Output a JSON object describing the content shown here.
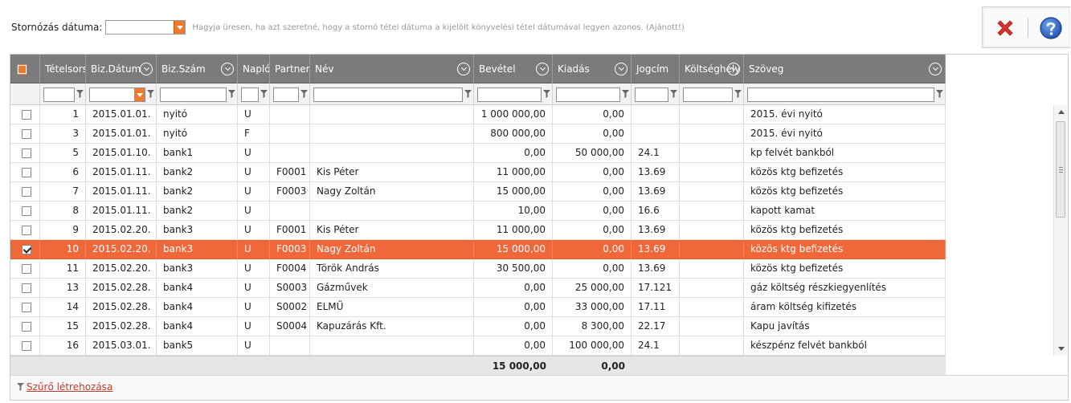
{
  "datebar": {
    "label": "Stornózás dátuma:",
    "value": "",
    "hint": "Hagyja üresen, ha azt szeretné, hogy a stornó tétel dátuma a kijelölt könyvelési tétel dátumával legyen azonos. (Ajánott!)"
  },
  "toolbar": {
    "close_icon": "close-icon",
    "help_icon": "help-icon"
  },
  "grid": {
    "columns": [
      {
        "key": "chk",
        "label": ""
      },
      {
        "key": "tetel",
        "label": "Tételsors"
      },
      {
        "key": "datum",
        "label": "Biz.Dátum"
      },
      {
        "key": "szam",
        "label": "Biz.Szám"
      },
      {
        "key": "naplo",
        "label": "Napló"
      },
      {
        "key": "partner",
        "label": "Partner"
      },
      {
        "key": "nev",
        "label": "Név"
      },
      {
        "key": "bevetel",
        "label": "Bevétel"
      },
      {
        "key": "kiadas",
        "label": "Kiadás"
      },
      {
        "key": "jogcim",
        "label": "Jogcím"
      },
      {
        "key": "koltseg",
        "label": "Költséghely"
      },
      {
        "key": "szoveg",
        "label": "Szöveg"
      }
    ],
    "rows": [
      {
        "checked": false,
        "selected": false,
        "tetel": "1",
        "datum": "2015.01.01.",
        "szam": "nyitó",
        "naplo": "U",
        "partner": "",
        "nev": "",
        "bevetel": "1 000 000,00",
        "kiadas": "0,00",
        "jogcim": "",
        "koltseg": "",
        "szoveg": "2015. évi nyitó"
      },
      {
        "checked": false,
        "selected": false,
        "tetel": "3",
        "datum": "2015.01.01.",
        "szam": "nyitó",
        "naplo": "F",
        "partner": "",
        "nev": "",
        "bevetel": "800 000,00",
        "kiadas": "0,00",
        "jogcim": "",
        "koltseg": "",
        "szoveg": "2015. évi nyitó"
      },
      {
        "checked": false,
        "selected": false,
        "tetel": "5",
        "datum": "2015.01.10.",
        "szam": "bank1",
        "naplo": "U",
        "partner": "",
        "nev": "",
        "bevetel": "0,00",
        "kiadas": "50 000,00",
        "jogcim": "24.1",
        "koltseg": "",
        "szoveg": "kp felvét bankból"
      },
      {
        "checked": false,
        "selected": false,
        "tetel": "6",
        "datum": "2015.01.11.",
        "szam": "bank2",
        "naplo": "U",
        "partner": "F0001",
        "nev": "Kis Péter",
        "bevetel": "11 000,00",
        "kiadas": "0,00",
        "jogcim": "13.69",
        "koltseg": "",
        "szoveg": "közös ktg befizetés"
      },
      {
        "checked": false,
        "selected": false,
        "tetel": "7",
        "datum": "2015.01.11.",
        "szam": "bank2",
        "naplo": "U",
        "partner": "F0003",
        "nev": "Nagy Zoltán",
        "bevetel": "15 000,00",
        "kiadas": "0,00",
        "jogcim": "13.69",
        "koltseg": "",
        "szoveg": "közös ktg befizetés"
      },
      {
        "checked": false,
        "selected": false,
        "tetel": "8",
        "datum": "2015.01.11.",
        "szam": "bank2",
        "naplo": "U",
        "partner": "",
        "nev": "",
        "bevetel": "10,00",
        "kiadas": "0,00",
        "jogcim": "16.6",
        "koltseg": "",
        "szoveg": "kapott kamat"
      },
      {
        "checked": false,
        "selected": false,
        "tetel": "9",
        "datum": "2015.02.20.",
        "szam": "bank3",
        "naplo": "U",
        "partner": "F0001",
        "nev": "Kis Péter",
        "bevetel": "11 000,00",
        "kiadas": "0,00",
        "jogcim": "13.69",
        "koltseg": "",
        "szoveg": "közös ktg befizetés"
      },
      {
        "checked": true,
        "selected": true,
        "tetel": "10",
        "datum": "2015.02.20.",
        "szam": "bank3",
        "naplo": "U",
        "partner": "F0003",
        "nev": "Nagy Zoltán",
        "bevetel": "15 000,00",
        "kiadas": "0,00",
        "jogcim": "13.69",
        "koltseg": "",
        "szoveg": "közös ktg befizetés"
      },
      {
        "checked": false,
        "selected": false,
        "tetel": "11",
        "datum": "2015.02.20.",
        "szam": "bank3",
        "naplo": "U",
        "partner": "F0004",
        "nev": "Török András",
        "bevetel": "30 500,00",
        "kiadas": "0,00",
        "jogcim": "13.69",
        "koltseg": "",
        "szoveg": "közös ktg befizetés"
      },
      {
        "checked": false,
        "selected": false,
        "tetel": "13",
        "datum": "2015.02.28.",
        "szam": "bank4",
        "naplo": "U",
        "partner": "S0003",
        "nev": "Gázművek",
        "bevetel": "0,00",
        "kiadas": "25 000,00",
        "jogcim": "17.121",
        "koltseg": "",
        "szoveg": "gáz költség részkiegyenlítés"
      },
      {
        "checked": false,
        "selected": false,
        "tetel": "14",
        "datum": "2015.02.28.",
        "szam": "bank4",
        "naplo": "U",
        "partner": "S0002",
        "nev": "ELMŰ",
        "bevetel": "0,00",
        "kiadas": "33 000,00",
        "jogcim": "17.11",
        "koltseg": "",
        "szoveg": "áram költség kifizetés"
      },
      {
        "checked": false,
        "selected": false,
        "tetel": "15",
        "datum": "2015.02.28.",
        "szam": "bank4",
        "naplo": "U",
        "partner": "S0004",
        "nev": "Kapuzárás Kft.",
        "bevetel": "0,00",
        "kiadas": "8 300,00",
        "jogcim": "22.17",
        "koltseg": "",
        "szoveg": "Kapu javítás"
      },
      {
        "checked": false,
        "selected": false,
        "tetel": "16",
        "datum": "2015.03.01.",
        "szam": "bank5",
        "naplo": "U",
        "partner": "",
        "nev": "",
        "bevetel": "0,00",
        "kiadas": "100 000,00",
        "jogcim": "24.1",
        "koltseg": "",
        "szoveg": "készpénz felvét bankból"
      }
    ],
    "totals": {
      "bevetel": "15 000,00",
      "kiadas": "0,00"
    },
    "colors": {
      "header": "#7b7b7b",
      "selected_row": "#f0683a",
      "accent": "#f07a2c"
    }
  },
  "footer": {
    "create_filter_link": "Szűrő létrehozása"
  }
}
